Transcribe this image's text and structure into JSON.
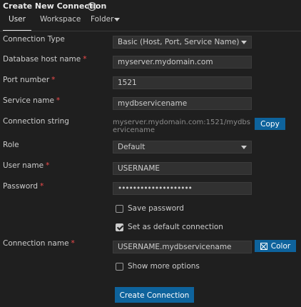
{
  "header": {
    "title": "Create New Connection",
    "info_icon": "i"
  },
  "tabs": [
    {
      "label": "User",
      "active": true
    },
    {
      "label": "Workspace",
      "active": false
    },
    {
      "label": "Folder",
      "active": false
    }
  ],
  "form": {
    "required_marker": "*",
    "connection_type": {
      "label": "Connection Type",
      "value": "Basic (Host, Port, Service Name)"
    },
    "host": {
      "label": "Database host name",
      "value": "myserver.mydomain.com"
    },
    "port": {
      "label": "Port number",
      "value": "1521"
    },
    "service": {
      "label": "Service name",
      "value": "mydbservicename"
    },
    "connection_string": {
      "label": "Connection string",
      "value": "myserver.mydomain.com:1521/mydbservicename",
      "copy_label": "Copy"
    },
    "role": {
      "label": "Role",
      "value": "Default"
    },
    "username": {
      "label": "User name",
      "value": "USERNAME"
    },
    "password": {
      "label": "Password",
      "value": "••••••••••••••••••••"
    },
    "save_password": {
      "label": "Save password",
      "checked": false
    },
    "default_connection": {
      "label": "Set as default connection",
      "checked": true
    },
    "connection_name": {
      "label": "Connection name",
      "value": "USERNAME.mydbservicename",
      "color_label": "Color"
    },
    "more_options": {
      "label": "Show more options",
      "checked": false
    },
    "submit_label": "Create Connection"
  },
  "colors": {
    "accent": "#0e639c",
    "background": "#1f1f1f",
    "input": "#313131",
    "required": "#f14c4c"
  }
}
